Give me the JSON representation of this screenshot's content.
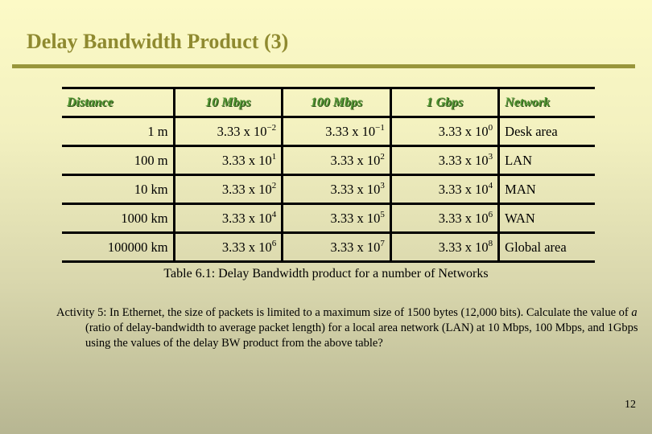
{
  "slide": {
    "title": "Delay Bandwidth Product (3)",
    "page_number": "12"
  },
  "table": {
    "headers": [
      "Distance",
      "10 Mbps",
      "100 Mbps",
      "1 Gbps",
      "Network"
    ],
    "rows": [
      {
        "distance": "1 m",
        "mbps10": {
          "base": "3.33 x 10",
          "exp": "−2"
        },
        "mbps100": {
          "base": "3.33 x 10",
          "exp": "−1"
        },
        "gbps1": {
          "base": "3.33 x 10",
          "exp": "0"
        },
        "network": "Desk area"
      },
      {
        "distance": "100 m",
        "mbps10": {
          "base": "3.33 x 10",
          "exp": "1"
        },
        "mbps100": {
          "base": "3.33 x 10",
          "exp": "2"
        },
        "gbps1": {
          "base": "3.33 x 10",
          "exp": "3"
        },
        "network": "LAN"
      },
      {
        "distance": "10 km",
        "mbps10": {
          "base": "3.33 x 10",
          "exp": "2"
        },
        "mbps100": {
          "base": "3.33 x 10",
          "exp": "3"
        },
        "gbps1": {
          "base": "3.33 x 10",
          "exp": "4"
        },
        "network": "MAN"
      },
      {
        "distance": "1000 km",
        "mbps10": {
          "base": "3.33 x 10",
          "exp": "4"
        },
        "mbps100": {
          "base": "3.33 x 10",
          "exp": "5"
        },
        "gbps1": {
          "base": "3.33 x 10",
          "exp": "6"
        },
        "network": "WAN"
      },
      {
        "distance": "100000 km",
        "mbps10": {
          "base": "3.33 x 10",
          "exp": "6"
        },
        "mbps100": {
          "base": "3.33 x 10",
          "exp": "7"
        },
        "gbps1": {
          "base": "3.33 x 10",
          "exp": "8"
        },
        "network": "Global area"
      }
    ],
    "caption": "Table 6.1: Delay Bandwidth product for a number of Networks"
  },
  "activity": {
    "prefix": "Activity 5: In Ethernet, the size of packets is limited to a maximum size of 1500 bytes (12,000 bits). Calculate the value of ",
    "variable": "a",
    "suffix": " (ratio of delay-bandwidth to average packet length) for a local area network (LAN) at 10 Mbps, 100 Mbps, and 1Gbps using the values of the delay BW product from the above table?"
  },
  "colors": {
    "title": "#8f8a30",
    "rule": "#99963b",
    "header_text": "#4f9330"
  }
}
